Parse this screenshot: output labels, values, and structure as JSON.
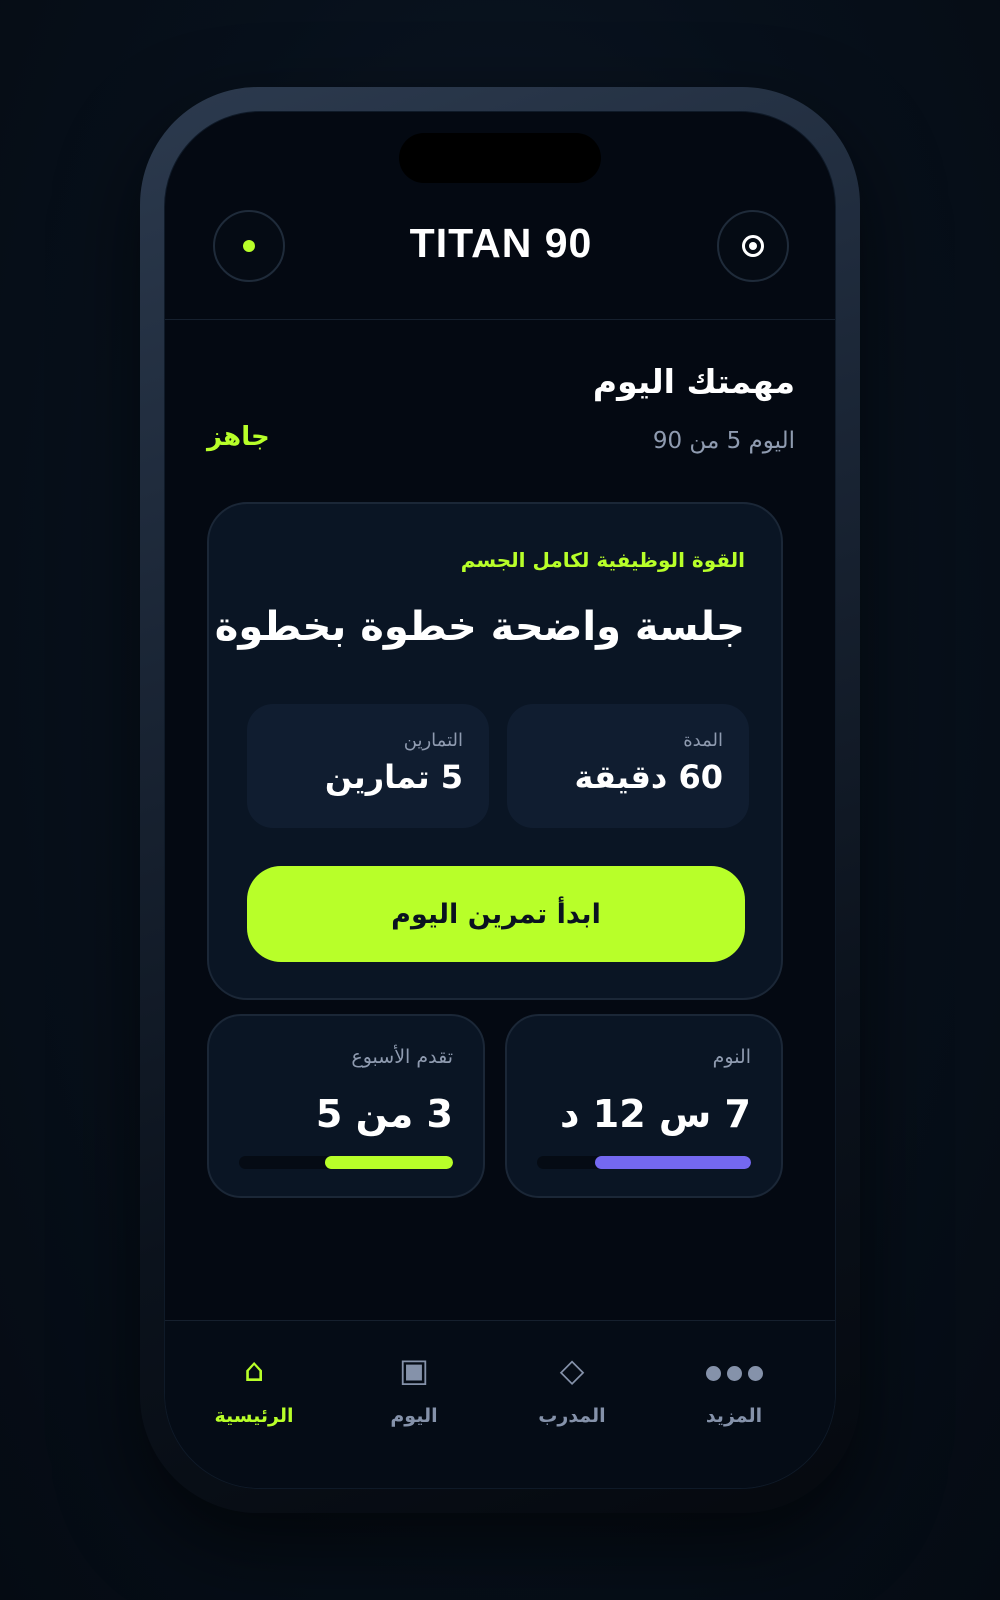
{
  "header": {
    "title": "TITAN 90",
    "left_button_icon": "status-dot-icon",
    "right_button_icon": "target-icon"
  },
  "mission": {
    "title": "مهمتك اليوم",
    "day_count": "اليوم 5 من 90",
    "status": "جاهز"
  },
  "workout": {
    "type": "القوة الوظيفية لكامل الجسم",
    "heading": "جلسة واضحة خطوة بخطوة",
    "duration_label": "المدة",
    "duration_value": "60 دقيقة",
    "exercises_label": "التمارين",
    "exercises_value": "5 تمارين",
    "start_button": "ابدأ تمرين اليوم"
  },
  "sleep": {
    "label": "النوم",
    "value": "7 س 12 د",
    "progress": 0.73,
    "color": "#7468f0"
  },
  "week_progress": {
    "label": "تقدم الأسبوع",
    "value": "3 من 5",
    "progress": 0.6,
    "color": "#b8ff29"
  },
  "nav": {
    "items": [
      {
        "label": "الرئيسية",
        "icon": "home-icon",
        "active": true
      },
      {
        "label": "اليوم",
        "icon": "calendar-square-icon",
        "active": false
      },
      {
        "label": "المدرب",
        "icon": "diamond-icon",
        "active": false
      },
      {
        "label": "المزيد",
        "icon": "more-dots-icon",
        "active": false
      }
    ]
  },
  "colors": {
    "accent": "#b8ff29",
    "background": "#040912",
    "card": "#0a1524",
    "muted_text": "#8f9bb0"
  }
}
